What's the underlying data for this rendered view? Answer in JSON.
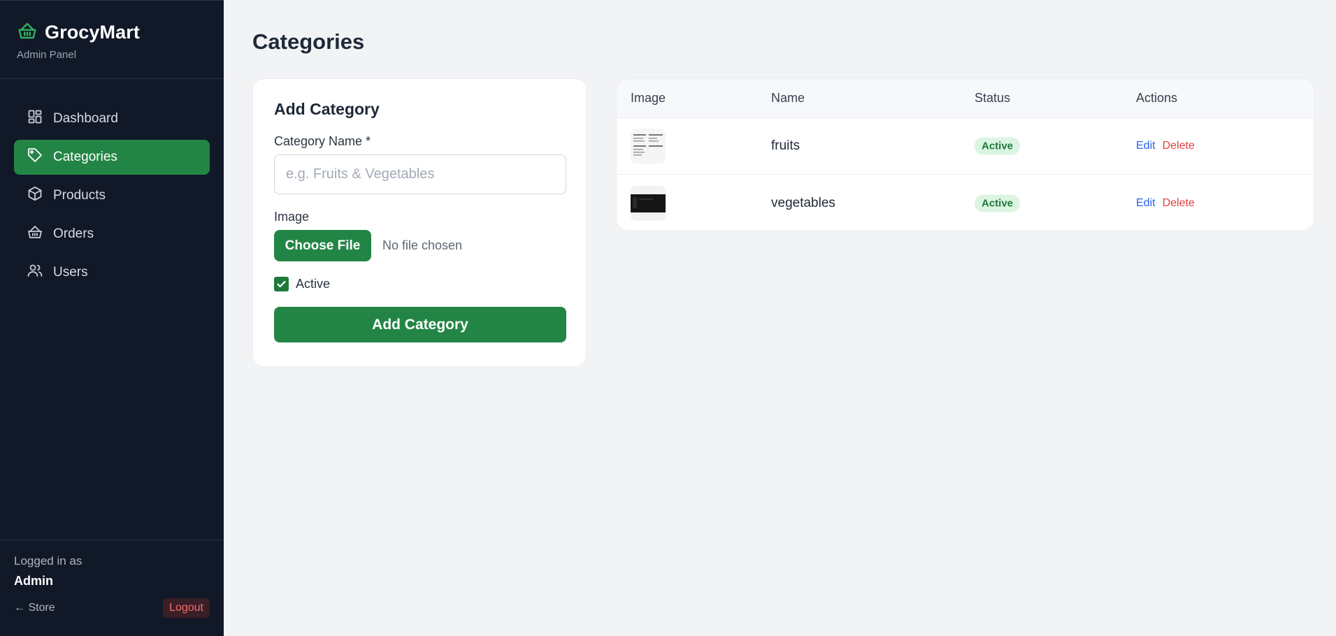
{
  "brand": {
    "name": "GrocyMart",
    "subtitle": "Admin Panel"
  },
  "sidebar": {
    "items": [
      {
        "label": "Dashboard",
        "icon": "dashboard-icon",
        "active": false
      },
      {
        "label": "Categories",
        "icon": "tag-icon",
        "active": true
      },
      {
        "label": "Products",
        "icon": "box-icon",
        "active": false
      },
      {
        "label": "Orders",
        "icon": "basket-icon",
        "active": false
      },
      {
        "label": "Users",
        "icon": "users-icon",
        "active": false
      }
    ],
    "footer": {
      "logged_in_label": "Logged in as",
      "user": "Admin",
      "store_link": "← Store",
      "logout_label": "Logout"
    }
  },
  "page": {
    "title": "Categories"
  },
  "form": {
    "title": "Add Category",
    "name_label": "Category Name *",
    "name_placeholder": "e.g. Fruits & Vegetables",
    "name_value": "",
    "image_label": "Image",
    "choose_file_label": "Choose File",
    "no_file_text": "No file chosen",
    "active_label": "Active",
    "active_checked": true,
    "submit_label": "Add Category"
  },
  "table": {
    "headers": [
      "Image",
      "Name",
      "Status",
      "Actions"
    ],
    "rows": [
      {
        "image": "fruits-thumbnail",
        "name": "fruits",
        "status": "Active",
        "edit": "Edit",
        "delete": "Delete"
      },
      {
        "image": "vegetables-thumbnail",
        "name": "vegetables",
        "status": "Active",
        "edit": "Edit",
        "delete": "Delete"
      }
    ]
  },
  "colors": {
    "sidebar_bg": "#111827",
    "accent_green": "#238545",
    "page_bg": "#f2f3f5",
    "badge_bg": "#dcf5e3",
    "badge_text": "#1e7a3c",
    "edit_blue": "#2563eb",
    "delete_red": "#e53e3e",
    "logout_red": "#f26b6b"
  }
}
